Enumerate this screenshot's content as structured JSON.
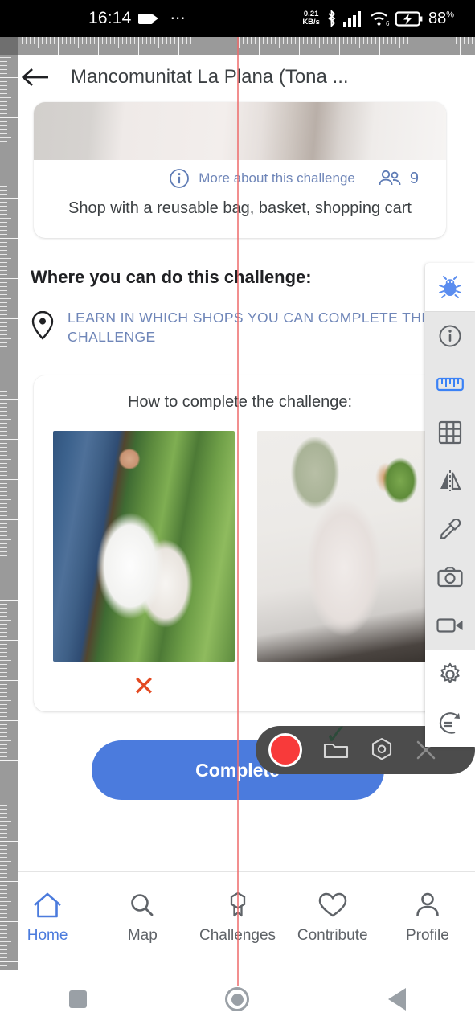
{
  "status_bar": {
    "time": "16:14",
    "recording_icon": "video-camera-icon",
    "overflow_icon": "more-dots-icon",
    "network_speed_value": "0.21",
    "network_speed_unit": "KB/s",
    "bluetooth_icon": "bluetooth-icon",
    "signal_icon": "cellular-signal-icon",
    "wifi_icon": "wifi-icon",
    "wifi_generation": "6",
    "battery_icon": "battery-charging-icon",
    "battery_percent": "88",
    "battery_percent_symbol": "%"
  },
  "app_bar": {
    "back_icon": "arrow-left-icon",
    "title": "Mancomunitat La Plana (Tona ..."
  },
  "challenge_card": {
    "info_icon": "info-circle-icon",
    "more_link": "More about this challenge",
    "people_icon": "people-icon",
    "participants_count": "9",
    "description": "Shop with a reusable bag, basket, shopping cart"
  },
  "where_section": {
    "heading": "Where you can do this challenge:",
    "pin_icon": "map-pin-icon",
    "link": "LEARN IN WHICH SHOPS YOU CAN COMPLETE THIS CHALLENGE"
  },
  "howto_section": {
    "title": "How to complete the challenge:",
    "items": [
      {
        "image_alt": "person-holding-plastic-bags",
        "marker": "✕",
        "marker_name": "cross-mark"
      },
      {
        "image_alt": "person-holding-canvas-tote-bag",
        "marker": "✓",
        "marker_name": "check-mark"
      }
    ]
  },
  "primary_action": {
    "label": "Complete"
  },
  "bottom_nav": {
    "active_index": 0,
    "items": [
      {
        "label": "Home",
        "icon": "home-icon"
      },
      {
        "label": "Map",
        "icon": "search-icon"
      },
      {
        "label": "Challenges",
        "icon": "badge-icon"
      },
      {
        "label": "Contribute",
        "icon": "heart-icon"
      },
      {
        "label": "Profile",
        "icon": "person-icon"
      }
    ]
  },
  "dev_toolbar": {
    "items": [
      {
        "icon": "bug-icon",
        "active": true
      },
      {
        "icon": "info-icon",
        "active": false
      },
      {
        "icon": "ruler-icon",
        "active": true
      },
      {
        "icon": "grid-icon",
        "active": false
      },
      {
        "icon": "mirror-flip-icon",
        "active": false
      },
      {
        "icon": "eyedropper-icon",
        "active": false
      },
      {
        "icon": "camera-icon",
        "active": false
      },
      {
        "icon": "video-icon",
        "active": false
      },
      {
        "icon": "gear-icon",
        "active": false
      },
      {
        "icon": "rotate-icon",
        "active": false
      }
    ]
  },
  "recorder_bar": {
    "record_icon": "record-button",
    "folder_icon": "folder-icon",
    "settings_icon": "hexagon-settings-icon",
    "close_icon": "close-x-icon"
  },
  "system_nav": {
    "recents_icon": "square-recents-icon",
    "home_icon": "circle-home-icon",
    "back_icon": "triangle-back-icon"
  },
  "colors": {
    "accent_blue": "#4b7bdd",
    "link_blue": "#6f86b8",
    "record_red": "#f83a3a",
    "cross_red": "#e34a22",
    "check_green": "#2d4a3a",
    "ruler_line": "#ed6a6a"
  }
}
